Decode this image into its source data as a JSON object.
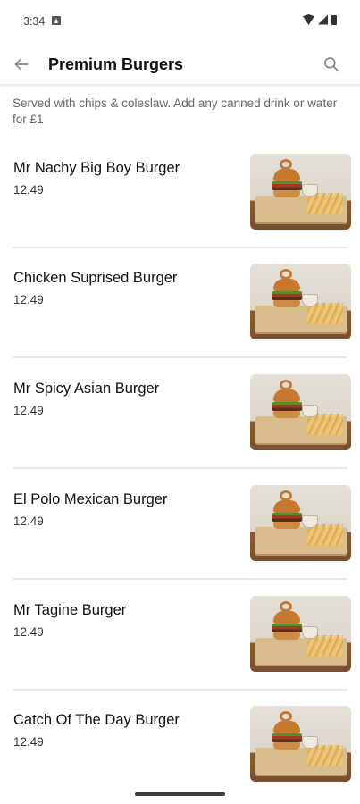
{
  "status_bar": {
    "time": "3:34"
  },
  "header": {
    "title": "Premium Burgers",
    "back_icon": "arrow-left-icon",
    "search_icon": "search-icon"
  },
  "category": {
    "description": "Served with chips & coleslaw. Add any canned drink or water for £1"
  },
  "items": [
    {
      "name": "Mr Nachy Big Boy Burger",
      "price": "12.49"
    },
    {
      "name": "Chicken Suprised Burger",
      "price": "12.49"
    },
    {
      "name": "Mr Spicy Asian Burger",
      "price": "12.49"
    },
    {
      "name": "El Polo Mexican Burger",
      "price": "12.49"
    },
    {
      "name": "Mr Tagine Burger",
      "price": "12.49"
    },
    {
      "name": "Catch Of The Day Burger",
      "price": "12.49"
    }
  ],
  "colors": {
    "text": "#111111",
    "muted": "#666666",
    "divider": "#e8e8e8"
  }
}
